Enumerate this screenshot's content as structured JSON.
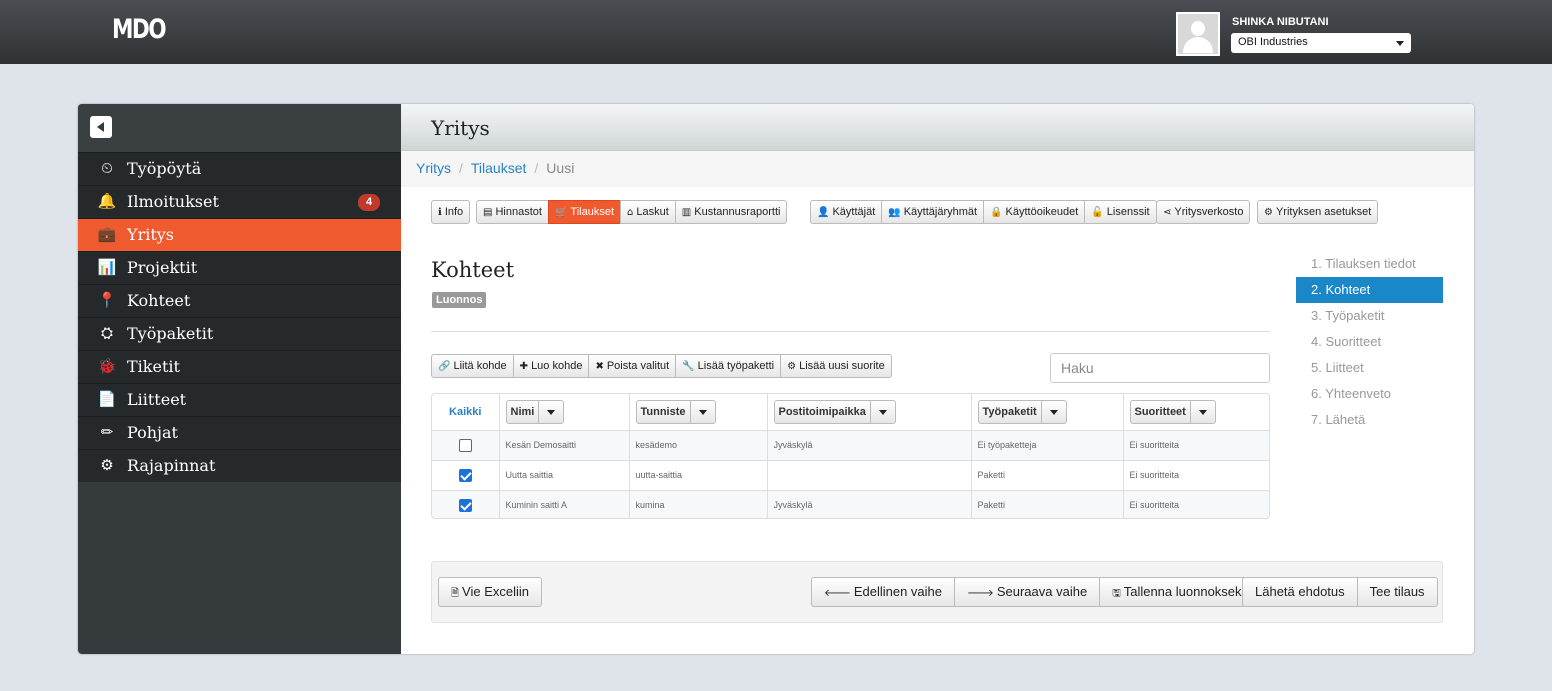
{
  "app": {
    "logo": "MDO"
  },
  "user": {
    "name": "SHINKA NIBUTANI",
    "company": "OBI Industries"
  },
  "sidebar": {
    "items": [
      {
        "label": "Työpöytä",
        "icon": "dashboard-icon",
        "glyph": "⏲"
      },
      {
        "label": "Ilmoitukset",
        "icon": "bell-icon",
        "glyph": "🔔",
        "badge": "4"
      },
      {
        "label": "Yritys",
        "icon": "briefcase-icon",
        "glyph": "💼",
        "active": true
      },
      {
        "label": "Projektit",
        "icon": "bar-chart-icon",
        "glyph": "📊"
      },
      {
        "label": "Kohteet",
        "icon": "map-marker-icon",
        "glyph": "📍"
      },
      {
        "label": "Työpaketit",
        "icon": "sitemap-icon",
        "glyph": "⛭"
      },
      {
        "label": "Tiketit",
        "icon": "bug-icon",
        "glyph": "🐞"
      },
      {
        "label": "Liitteet",
        "icon": "file-icon",
        "glyph": "📄"
      },
      {
        "label": "Pohjat",
        "icon": "pencil-icon",
        "glyph": "✏"
      },
      {
        "label": "Rajapinnat",
        "icon": "cogs-icon",
        "glyph": "⚙"
      }
    ]
  },
  "page": {
    "title": "Yritys"
  },
  "breadcrumb": [
    "Yritys",
    "Tilaukset",
    "Uusi"
  ],
  "tabs": {
    "group1": [
      {
        "label": "Info",
        "glyph": "ℹ"
      }
    ],
    "group2": [
      {
        "label": "Hinnastot",
        "glyph": "▤"
      },
      {
        "label": "Tilaukset",
        "glyph": "🛒",
        "active": true
      },
      {
        "label": "Laskut",
        "glyph": "⌂"
      },
      {
        "label": "Kustannusraportti",
        "glyph": "▥"
      }
    ],
    "group3": [
      {
        "label": "Käyttäjät",
        "glyph": "👤"
      },
      {
        "label": "Käyttäjäryhmät",
        "glyph": "👥"
      },
      {
        "label": "Käyttöoikeudet",
        "glyph": "🔒"
      },
      {
        "label": "Lisenssit",
        "glyph": "🔓"
      }
    ],
    "group4": [
      {
        "label": "Yritysverkosto",
        "glyph": "⋖"
      }
    ],
    "group5": [
      {
        "label": "Yrityksen asetukset",
        "glyph": "⚙"
      }
    ]
  },
  "section": {
    "title": "Kohteet",
    "status": "Luonnos"
  },
  "toolbar": [
    {
      "label": "Liitä kohde",
      "glyph": "🔗"
    },
    {
      "label": "Luo kohde",
      "glyph": "✚"
    },
    {
      "label": "Poista valitut",
      "glyph": "✖"
    },
    {
      "label": "Lisää työpaketti",
      "glyph": "🔧"
    },
    {
      "label": "Lisää uusi suorite",
      "glyph": "⚙"
    }
  ],
  "search": {
    "placeholder": "Haku"
  },
  "table": {
    "select_all": "Kaikki",
    "columns": [
      "Nimi",
      "Tunniste",
      "Postitoimipaikka",
      "Työpaketit",
      "Suoritteet"
    ],
    "rows": [
      {
        "checked": false,
        "cells": [
          "Kesän Demosaitti",
          "kesädemo",
          "Jyväskylä",
          "Ei työpaketteja",
          "Ei suoritteita"
        ]
      },
      {
        "checked": true,
        "cells": [
          "Uutta saittia",
          "uutta-saittia",
          "",
          "Paketti",
          "Ei suoritteita"
        ]
      },
      {
        "checked": true,
        "cells": [
          "Kuminin saitti A",
          "kumina",
          "Jyväskylä",
          "Paketti",
          "Ei suoritteita"
        ]
      }
    ]
  },
  "steps": [
    {
      "label": "1. Tilauksen tiedot"
    },
    {
      "label": "2. Kohteet",
      "active": true
    },
    {
      "label": "3. Työpaketit"
    },
    {
      "label": "4. Suoritteet"
    },
    {
      "label": "5. Liitteet"
    },
    {
      "label": "6. Yhteenveto"
    },
    {
      "label": "7. Lähetä"
    }
  ],
  "footer": {
    "export": {
      "label": "Vie Exceliin",
      "glyph": "🗎"
    },
    "nav": [
      {
        "label": "Edellinen vaihe",
        "glyph": "🡐"
      },
      {
        "label": "Seuraava vaihe",
        "glyph": "🡒"
      },
      {
        "label": "Tallenna luonnokseksi",
        "glyph": "🖫"
      }
    ],
    "submit": [
      {
        "label": "Lähetä ehdotus"
      },
      {
        "label": "Tee tilaus"
      }
    ]
  }
}
